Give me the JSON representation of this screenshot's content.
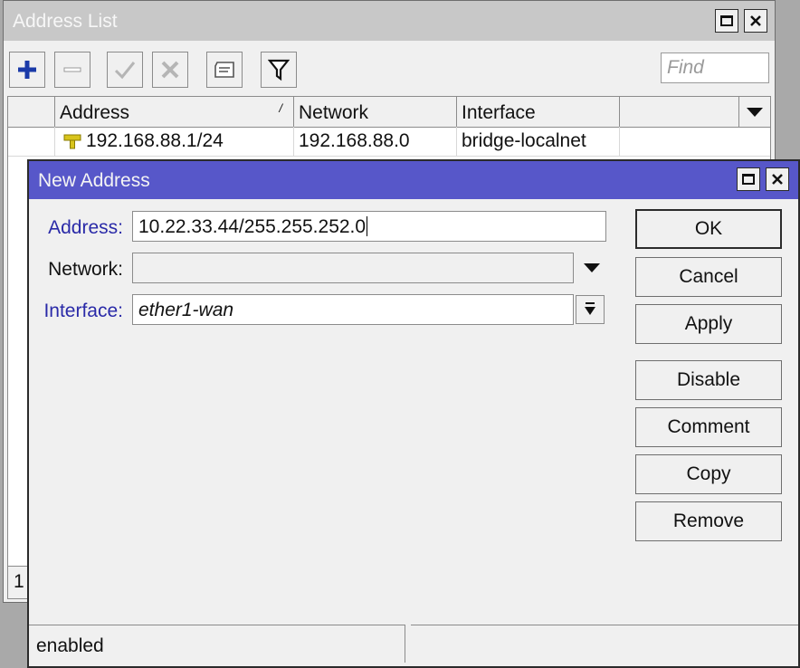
{
  "back_window": {
    "title": "Address List",
    "find_placeholder": "Find",
    "columns": [
      "Address",
      "Network",
      "Interface"
    ],
    "rows": [
      {
        "address": "192.168.88.1/24",
        "network": "192.168.88.0",
        "interface": "bridge-localnet"
      }
    ],
    "status_count": "1"
  },
  "dialog": {
    "title": "New Address",
    "fields": {
      "address_label": "Address:",
      "address_value": "10.22.33.44/255.255.252.0",
      "network_label": "Network:",
      "network_value": "",
      "interface_label": "Interface:",
      "interface_value": "ether1-wan"
    },
    "buttons": {
      "ok": "OK",
      "cancel": "Cancel",
      "apply": "Apply",
      "disable": "Disable",
      "comment": "Comment",
      "copy": "Copy",
      "remove": "Remove"
    },
    "status": "enabled"
  },
  "colors": {
    "dialog_titlebar": "#5757c9",
    "label_blue": "#2a2aa8",
    "add_icon": "#1a3aa8",
    "address_icon": "#d8c41c"
  }
}
